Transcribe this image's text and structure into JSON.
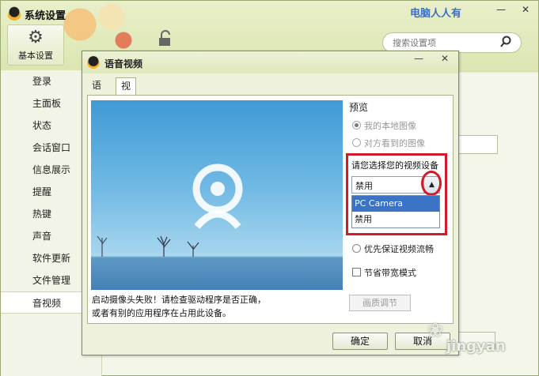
{
  "main_window": {
    "title": "系统设置",
    "watermark_top": "电脑人人有",
    "min_glyph": "—",
    "close_glyph": "✕",
    "nav_basic_label": "基本设置",
    "nav_basic_icon": "gear-icon",
    "nav_security_icon": "lock-icon",
    "search_placeholder": "搜索设置项",
    "search_icon": "search-icon"
  },
  "sidebar": {
    "items": [
      {
        "label": "登录"
      },
      {
        "label": "主面板"
      },
      {
        "label": "状态"
      },
      {
        "label": "会话窗口"
      },
      {
        "label": "信息展示"
      },
      {
        "label": "提醒"
      },
      {
        "label": "热键"
      },
      {
        "label": "声音"
      },
      {
        "label": "软件更新"
      },
      {
        "label": "文件管理"
      },
      {
        "label": "音视频",
        "active": true
      }
    ]
  },
  "dialog": {
    "title": "语音视频",
    "min_glyph": "—",
    "close_glyph": "✕",
    "tabs": [
      {
        "label": "语音"
      },
      {
        "label": "视频",
        "active": true
      }
    ],
    "preview_label": "预览",
    "radio_local": "我的本地图像",
    "radio_remote": "对方看到的图像",
    "device_label": "请您选择您的视频设备",
    "device_selected": "禁用",
    "device_options": [
      "PC Camera",
      "禁用"
    ],
    "device_highlighted": "PC Camera",
    "smooth_label": "优先保证视频流畅",
    "bandwidth_label": "节省带宽模式",
    "quality_button": "画质调节",
    "fail_message": "启动摄像头失败！请检查驱动程序是否正确，或者有别的应用程序在占用此设备。",
    "ok_button": "确定",
    "cancel_button": "取消"
  },
  "colors": {
    "highlight_red": "#d11b2a",
    "selection_blue": "#3b73c5",
    "preview_sky": "#3f9bd5"
  },
  "watermark": {
    "text": "jingyan"
  }
}
